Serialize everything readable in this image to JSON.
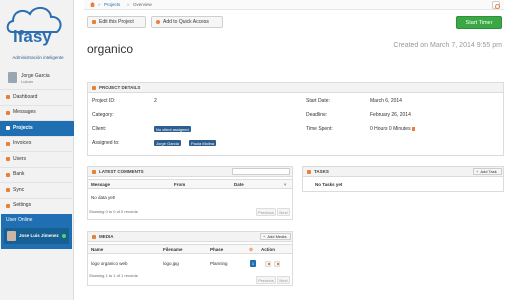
{
  "brand": {
    "logo_text": "ifasy",
    "tagline": "Administración inteligente"
  },
  "user": {
    "name": "Jorge Garcia",
    "role": "Lukum"
  },
  "nav": [
    {
      "label": "Dashboard",
      "icon": "dashboard-icon"
    },
    {
      "label": "Messages",
      "icon": "messages-icon"
    },
    {
      "label": "Projects",
      "icon": "projects-icon",
      "active": true
    },
    {
      "label": "Invoices",
      "icon": "invoices-icon"
    },
    {
      "label": "Users",
      "icon": "users-icon"
    },
    {
      "label": "Bank",
      "icon": "bank-icon"
    },
    {
      "label": "Sync",
      "icon": "sync-icon"
    },
    {
      "label": "Settings",
      "icon": "settings-icon"
    }
  ],
  "online": {
    "title": "User Online",
    "user": "Jose Luis Jimenez"
  },
  "breadcrumb": {
    "projects": "Projects",
    "separator": "»",
    "current": "Overview"
  },
  "toolbar": {
    "edit": "Edit this Project",
    "quick_access": "Add to Quick Access",
    "start_timer": "Start Timer"
  },
  "project": {
    "title": "organico",
    "created": "Created on March 7, 2014 9:55 pm"
  },
  "details": {
    "header": "PROJECT DETAILS",
    "project_id_label": "Project ID:",
    "project_id": "2",
    "category_label": "Category:",
    "category": "",
    "client_label": "Client:",
    "client": "No client assigned",
    "assigned_label": "Assigned to:",
    "assigned": [
      "Jorge Garcia",
      "Paola Molina"
    ],
    "start_label": "Start Date:",
    "start": "March 6, 2014",
    "deadline_label": "Deadline:",
    "deadline": "February 26, 2014",
    "time_label": "Time Spent:",
    "time": "0 Hours 0 Minutes"
  },
  "comments": {
    "header": "LATEST COMMENTS",
    "columns": [
      "Message",
      "From",
      "Date"
    ],
    "empty": "No data yet!",
    "info": "Showing 0 to 0 of 0 records",
    "prev": "Previous",
    "next": "Next"
  },
  "tasks": {
    "header": "TASKS",
    "add": "Add Task",
    "empty": "No Tasks yet"
  },
  "media": {
    "header": "MEDIA",
    "add": "Add Media",
    "columns": [
      "Name",
      "Filename",
      "Phase",
      "Action"
    ],
    "rows": [
      {
        "name": "logo organico web",
        "filename": "logo.jpg",
        "phase": "Planning",
        "count": "1"
      }
    ],
    "info": "Showing 1 to 1 of 1 records",
    "prev": "Previous",
    "next": "Next"
  },
  "colors": {
    "primary": "#1f6fb2",
    "accent": "#e8803a",
    "success": "#39a845"
  }
}
